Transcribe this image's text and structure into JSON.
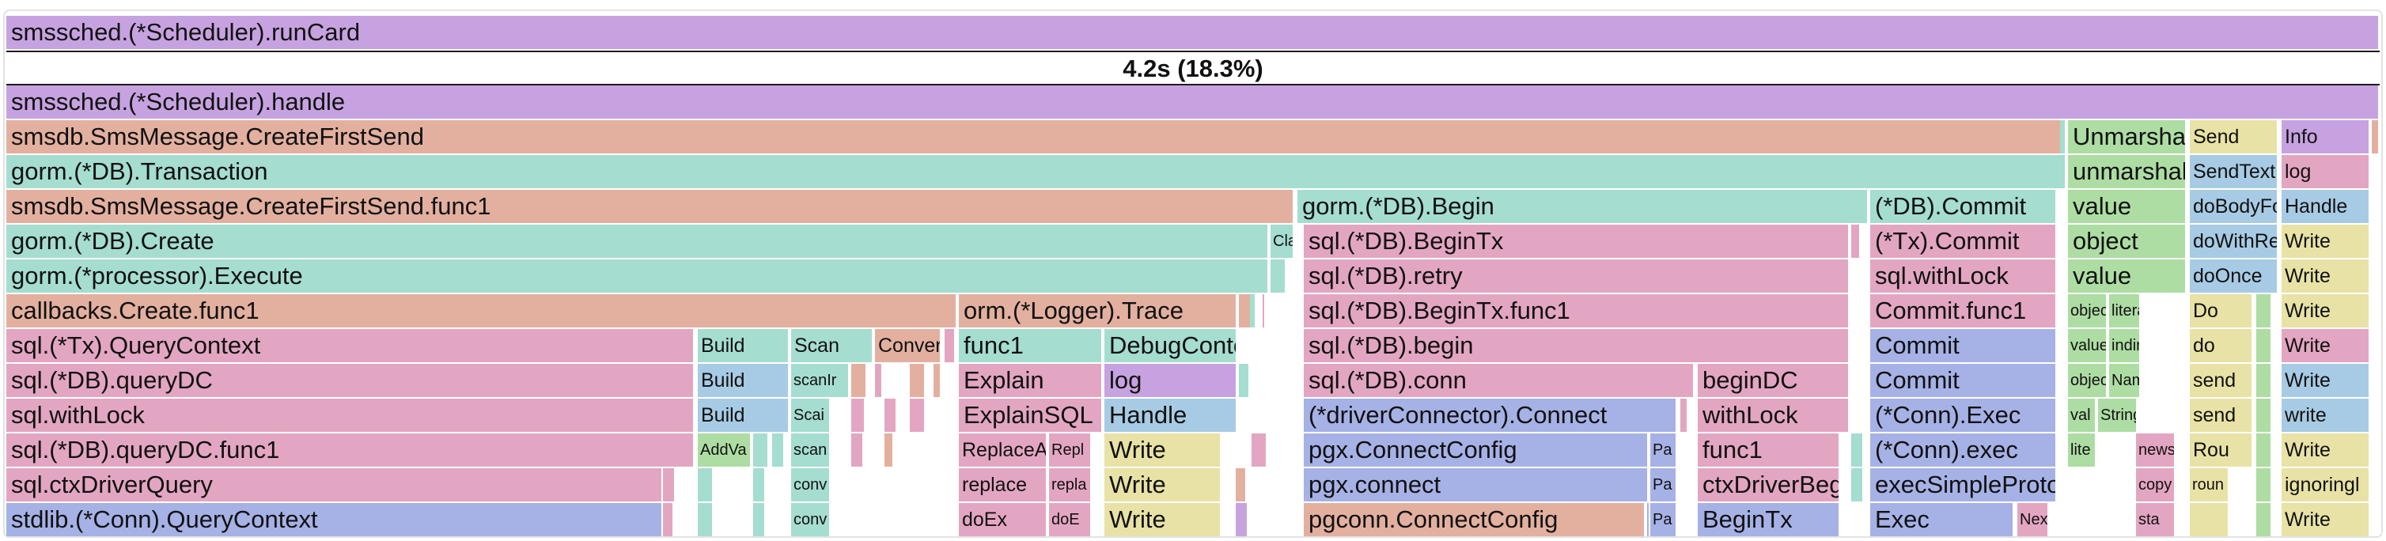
{
  "summary": "4.2s (18.3%)",
  "colors": {
    "purple": "#c7a2e0",
    "salmon": "#e3b09f",
    "teal": "#a5ddd0",
    "pink": "#e3a6c2",
    "blue": "#a6b2e6",
    "green": "#addda3",
    "yellow": "#e8e2a6",
    "lightblue": "#a7cbe4",
    "gray": "#e8e8e8"
  },
  "rows": [
    [
      [
        "smssched.(*Scheduler).runCard",
        "purple"
      ]
    ],
    [
      [
        "smssched.(*Scheduler).handle",
        "purple"
      ]
    ],
    [
      [
        "smsdb.SmsMessage.CreateFirstSend",
        "salmon"
      ],
      [
        "Unmarshal",
        "green"
      ],
      [
        "Send",
        "yellow"
      ],
      [
        "Info",
        "purple"
      ],
      [
        "",
        "salmon"
      ]
    ],
    [
      [
        "gorm.(*DB).Transaction",
        "teal"
      ],
      [
        "unmarshal",
        "green"
      ],
      [
        "SendText",
        "lightblue"
      ],
      [
        "log",
        "pink"
      ]
    ],
    [
      [
        "smsdb.SmsMessage.CreateFirstSend.func1",
        "salmon"
      ],
      [
        "gorm.(*DB).Begin",
        "teal"
      ],
      [
        "(*DB).Commit",
        "teal"
      ],
      [
        "value",
        "green"
      ],
      [
        "doBodyFo",
        "lightblue"
      ],
      [
        "Handle",
        "lightblue"
      ]
    ],
    [
      [
        "gorm.(*DB).Create",
        "teal"
      ],
      [
        "Cla",
        "teal"
      ],
      [
        "sql.(*DB).BeginTx",
        "pink"
      ],
      [
        "",
        "pink"
      ],
      [
        "(*Tx).Commit",
        "pink"
      ],
      [
        "object",
        "green"
      ],
      [
        "doWithRe",
        "lightblue"
      ],
      [
        "Write",
        "yellow"
      ]
    ],
    [
      [
        "gorm.(*processor).Execute",
        "teal"
      ],
      [
        "",
        "teal"
      ],
      [
        "sql.(*DB).retry",
        "pink"
      ],
      [
        "sql.withLock",
        "pink"
      ],
      [
        "value",
        "green"
      ],
      [
        "doOnce",
        "lightblue"
      ],
      [
        "Write",
        "yellow"
      ]
    ],
    [
      [
        "callbacks.Create.func1",
        "salmon"
      ],
      [
        "orm.(*Logger).Trace",
        "salmon"
      ],
      [
        "",
        "salmon"
      ],
      [
        "sql.(*DB).BeginTx.func1",
        "pink"
      ],
      [
        "Commit.func1",
        "pink"
      ],
      [
        "object",
        "green"
      ],
      [
        "litera",
        "green"
      ],
      [
        "Do",
        "yellow"
      ],
      [
        "",
        "green"
      ],
      [
        "Write",
        "yellow"
      ]
    ],
    [
      [
        "sql.(*Tx).QueryContext",
        "pink"
      ],
      [
        "Build",
        "teal"
      ],
      [
        "Scan",
        "teal"
      ],
      [
        "Conver",
        "salmon"
      ],
      [
        "func1",
        "teal"
      ],
      [
        "DebugContext",
        "teal"
      ],
      [
        "sql.(*DB).begin",
        "pink"
      ],
      [
        "Commit",
        "blue"
      ],
      [
        "value",
        "green"
      ],
      [
        "indire",
        "green"
      ],
      [
        "do",
        "yellow"
      ],
      [
        "",
        "green"
      ],
      [
        "Write",
        "pink"
      ]
    ],
    [
      [
        "sql.(*DB).queryDC",
        "pink"
      ],
      [
        "Build",
        "lightblue"
      ],
      [
        "scanIr",
        "teal"
      ],
      [
        "Explain",
        "pink"
      ],
      [
        "log",
        "purple"
      ],
      [
        "sql.(*DB).conn",
        "pink"
      ],
      [
        "beginDC",
        "pink"
      ],
      [
        "Commit",
        "blue"
      ],
      [
        "object",
        "green"
      ],
      [
        "Nam",
        "green"
      ],
      [
        "send",
        "yellow"
      ],
      [
        "",
        "green"
      ],
      [
        "Write",
        "lightblue"
      ]
    ],
    [
      [
        "sql.withLock",
        "pink"
      ],
      [
        "Build",
        "lightblue"
      ],
      [
        "Scai",
        "teal"
      ],
      [
        "ExplainSQL",
        "pink"
      ],
      [
        "Handle",
        "lightblue"
      ],
      [
        "(*driverConnector).Connect",
        "blue"
      ],
      [
        "withLock",
        "pink"
      ],
      [
        "(*Conn).Exec",
        "blue"
      ],
      [
        "val",
        "green"
      ],
      [
        "String",
        "green"
      ],
      [
        "send",
        "yellow"
      ],
      [
        "",
        "green"
      ],
      [
        "write",
        "lightblue"
      ]
    ],
    [
      [
        "sql.(*DB).queryDC.func1",
        "pink"
      ],
      [
        "AddVa",
        "green"
      ],
      [
        "scan",
        "teal"
      ],
      [
        "ReplaceAl",
        "pink"
      ],
      [
        "Repl",
        "pink"
      ],
      [
        "Write",
        "yellow"
      ],
      [
        "pgx.ConnectConfig",
        "blue"
      ],
      [
        "Pa",
        "blue"
      ],
      [
        "func1",
        "pink"
      ],
      [
        "(*Conn).exec",
        "blue"
      ],
      [
        "lite",
        "green"
      ],
      [
        "news",
        "pink"
      ],
      [
        "Rou",
        "yellow"
      ],
      [
        "",
        "green"
      ],
      [
        "Write",
        "yellow"
      ]
    ],
    [
      [
        "sql.ctxDriverQuery",
        "pink"
      ],
      [
        "conv",
        "teal"
      ],
      [
        "replace",
        "pink"
      ],
      [
        "repla",
        "pink"
      ],
      [
        "Write",
        "yellow"
      ],
      [
        "pgx.connect",
        "blue"
      ],
      [
        "Pa",
        "blue"
      ],
      [
        "ctxDriverBegin",
        "pink"
      ],
      [
        "execSimpleProtocol",
        "blue"
      ],
      [
        "copy",
        "pink"
      ],
      [
        "roun",
        "yellow"
      ],
      [
        "",
        "green"
      ],
      [
        "ignoringl",
        "yellow"
      ]
    ],
    [
      [
        "stdlib.(*Conn).QueryContext",
        "blue"
      ],
      [
        "conv",
        "teal"
      ],
      [
        "doEx",
        "pink"
      ],
      [
        "doE",
        "pink"
      ],
      [
        "Write",
        "yellow"
      ],
      [
        "pgconn.ConnectConfig",
        "salmon"
      ],
      [
        "Pa",
        "blue"
      ],
      [
        "BeginTx",
        "blue"
      ],
      [
        "Exec",
        "blue"
      ],
      [
        "Nex",
        "pink"
      ],
      [
        "sta",
        "pink"
      ],
      [
        "",
        "yellow"
      ],
      [
        "",
        "green"
      ],
      [
        "Write",
        "yellow"
      ]
    ]
  ]
}
